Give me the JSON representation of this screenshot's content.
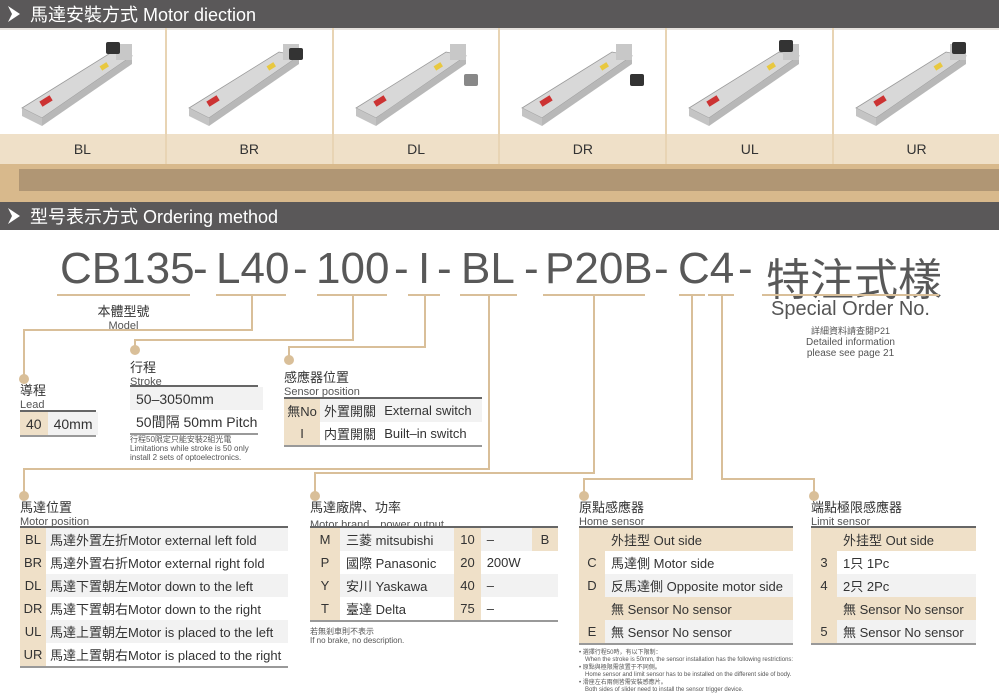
{
  "section1": {
    "title": "馬達安裝方式 Motor diection",
    "icon": "chevron-right-icon"
  },
  "motor_directions": [
    {
      "code": "BL",
      "image": "linear-actuator-image"
    },
    {
      "code": "BR",
      "image": "linear-actuator-image"
    },
    {
      "code": "DL",
      "image": "linear-actuator-image"
    },
    {
      "code": "DR",
      "image": "linear-actuator-image"
    },
    {
      "code": "UL",
      "image": "linear-actuator-image"
    },
    {
      "code": "UR",
      "image": "linear-actuator-image"
    }
  ],
  "section2": {
    "title": "型号表示方式  Ordering method",
    "icon": "chevron-right-icon"
  },
  "code": {
    "parts": [
      "CB135",
      "L40",
      "100",
      "I",
      "BL",
      "P20B",
      "C4",
      "特注式樣"
    ],
    "separator": "-"
  },
  "model": {
    "cn": "本體型號",
    "en": "Model"
  },
  "special": {
    "title": "Special Order No.",
    "cn_note": "詳細資料請查閱P21",
    "en_note1": "Detailed information",
    "en_note2": "please see page 21"
  },
  "lead": {
    "cn": "導程",
    "en": "Lead",
    "rows": [
      {
        "key": "40",
        "value": "40mm"
      }
    ]
  },
  "stroke": {
    "cn": "行程",
    "en": "Stroke",
    "rows": [
      "50–3050mm",
      "50間隔 50mm Pitch"
    ],
    "note_cn": "行程50限定只能安裝2組光電",
    "note_en1": "Limitations while stroke is 50 only",
    "note_en2": "install 2 sets of optoelectronics."
  },
  "sensor_position": {
    "cn": "感應器位置",
    "en": "Sensor position",
    "rows": [
      {
        "key": "無No",
        "cn": "外置開關",
        "en": "External switch"
      },
      {
        "key": "I",
        "cn": "内置開關",
        "en": "Built–in switch"
      }
    ]
  },
  "motor_position": {
    "cn": "馬達位置",
    "en": "Motor position",
    "rows": [
      {
        "key": "BL",
        "desc": "馬達外置左折Motor external left fold"
      },
      {
        "key": "BR",
        "desc": "馬達外置右折Motor external right fold"
      },
      {
        "key": "DL",
        "desc": "馬達下置朝左Motor down to the left"
      },
      {
        "key": "DR",
        "desc": "馬達下置朝右Motor down to the right"
      },
      {
        "key": "UL",
        "desc": "馬達上置朝左Motor is placed to the left"
      },
      {
        "key": "UR",
        "desc": "馬達上置朝右Motor is placed to the right"
      }
    ]
  },
  "motor_brand": {
    "cn": "馬達廠牌、功率",
    "en": "Motor brand、power output",
    "rows": [
      {
        "key": "M",
        "brand": "三菱 mitsubishi",
        "power_key": "10",
        "power": "–",
        "brake": "B"
      },
      {
        "key": "P",
        "brand": "國際 Panasonic",
        "power_key": "20",
        "power": "200W",
        "brake": ""
      },
      {
        "key": "Y",
        "brand": "安川 Yaskawa",
        "power_key": "40",
        "power": "–",
        "brake": ""
      },
      {
        "key": "T",
        "brand": "臺達 Delta",
        "power_key": "75",
        "power": "–",
        "brake": ""
      }
    ],
    "note_cn": "若無剎車則不表示",
    "note_en": "If no brake, no description."
  },
  "home_sensor": {
    "cn": "原點感應器",
    "en": "Home sensor",
    "rows": [
      {
        "key": "",
        "desc": "外挂型 Out side",
        "header": true
      },
      {
        "key": "C",
        "desc": "馬達側 Motor side"
      },
      {
        "key": "D",
        "desc": "反馬達側 Opposite motor side"
      },
      {
        "key": "",
        "desc": "無 Sensor No sensor",
        "header": true
      },
      {
        "key": "E",
        "desc": "無 Sensor No sensor"
      }
    ]
  },
  "limit_sensor": {
    "cn": "端點極限感應器",
    "en": "Limit sensor",
    "rows": [
      {
        "key": "",
        "desc": "外挂型 Out side",
        "header": true
      },
      {
        "key": "3",
        "desc": "1只 1Pc"
      },
      {
        "key": "4",
        "desc": "2只 2Pc"
      },
      {
        "key": "",
        "desc": "無 Sensor No sensor",
        "header": true
      },
      {
        "key": "5",
        "desc": "無 Sensor No sensor"
      }
    ]
  },
  "footnotes": [
    {
      "cn": "選擇行程50時，有以下限制：",
      "en": "When the stroke is 50mm, the sensor installation has the following restrictions:"
    },
    {
      "cn": "原點與極限需放置于不同側。",
      "en": "Home sensor and limit sensor has to be installed on the different side of body."
    },
    {
      "cn": "滑座左右兩側皆需安裝感應片。",
      "en": "Both sides of slider need to install the sensor trigger device."
    }
  ],
  "colors": {
    "header_bg": "#5a5859",
    "accent": "#d9bf99",
    "key_bg": "#efe0c8",
    "band": "#b09674"
  }
}
